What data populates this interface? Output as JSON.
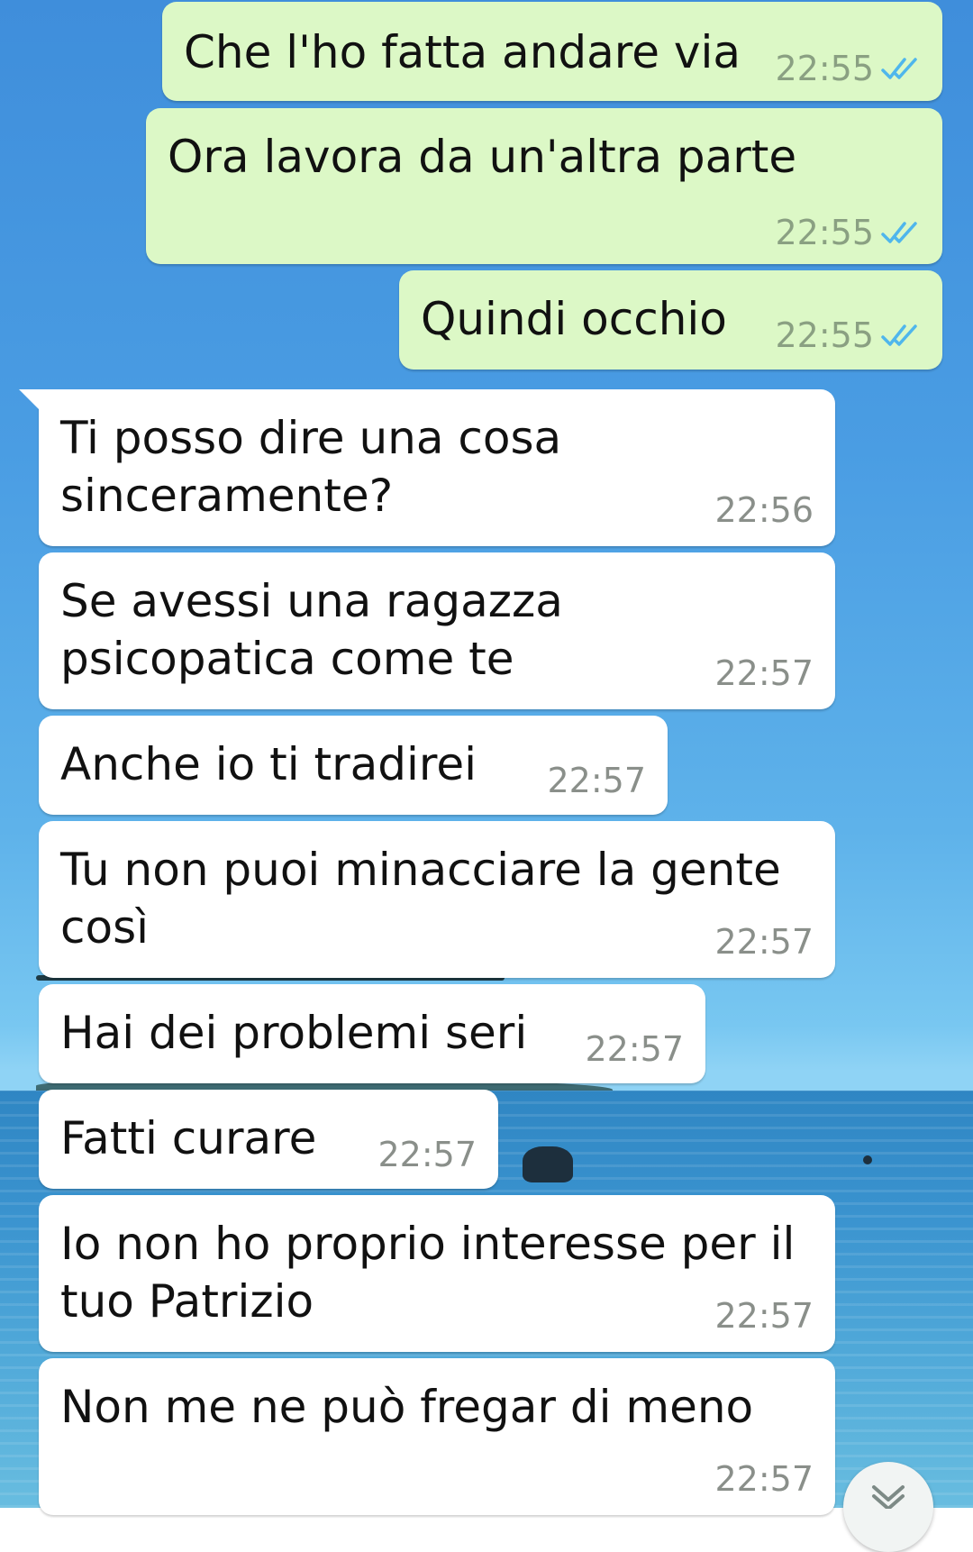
{
  "messages": [
    {
      "text": "Che l'ho fatta andare via",
      "time": "22:55",
      "direction": "out",
      "status": "read"
    },
    {
      "text": "Ora lavora da un'altra parte",
      "time": "22:55",
      "direction": "out",
      "status": "read"
    },
    {
      "text": "Quindi occhio",
      "time": "22:55",
      "direction": "out",
      "status": "read"
    },
    {
      "text": "Ti posso dire una cosa\nsinceramente?",
      "time": "22:56",
      "direction": "in"
    },
    {
      "text": "Se avessi una ragazza\npsicopatica come te",
      "time": "22:57",
      "direction": "in"
    },
    {
      "text": "Anche io ti tradirei",
      "time": "22:57",
      "direction": "in"
    },
    {
      "text": "Tu non puoi minacciare la gente\ncosì",
      "time": "22:57",
      "direction": "in"
    },
    {
      "text": "Hai dei problemi seri",
      "time": "22:57",
      "direction": "in"
    },
    {
      "text": "Fatti curare",
      "time": "22:57",
      "direction": "in"
    },
    {
      "text": "Io non ho proprio interesse per il\ntuo Patrizio",
      "time": "22:57",
      "direction": "in"
    },
    {
      "text": "Non me ne può fregar di meno",
      "time": "22:57",
      "direction": "in"
    }
  ],
  "icons": {
    "read_ticks": "double-check-icon",
    "scroll_down": "chevron-down-icon"
  },
  "colors": {
    "outgoing_bubble": "#dcf8c6",
    "incoming_bubble": "#ffffff",
    "read_ticks": "#4fb6ec",
    "timestamp": "#8a8f8a"
  }
}
